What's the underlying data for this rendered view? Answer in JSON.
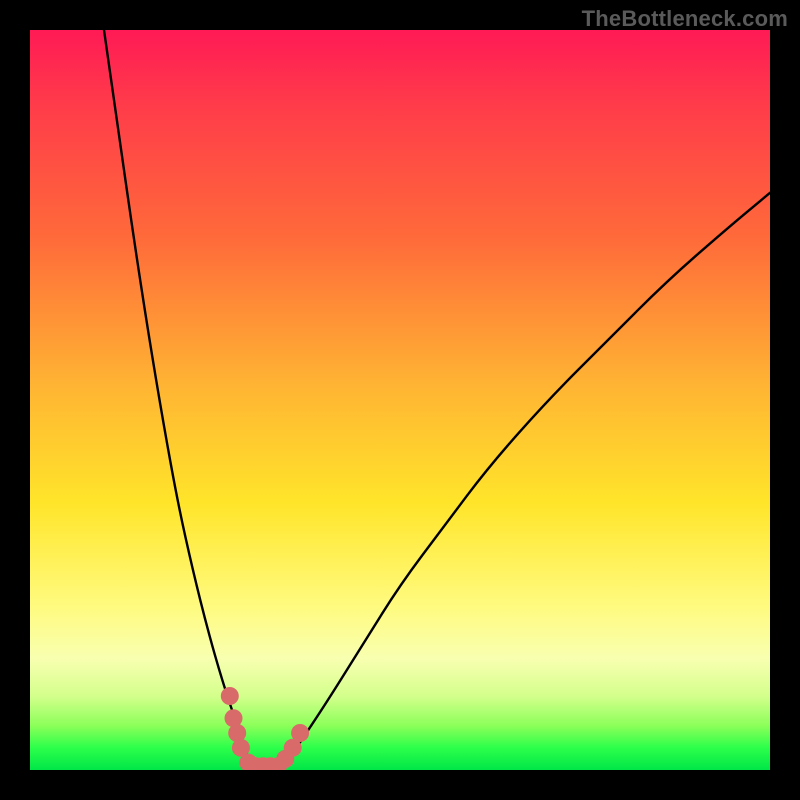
{
  "watermark": "TheBottleneck.com",
  "chart_data": {
    "type": "line",
    "title": "",
    "xlabel": "",
    "ylabel": "",
    "xlim": [
      0,
      100
    ],
    "ylim": [
      0,
      100
    ],
    "series": [
      {
        "name": "left-curve",
        "x": [
          10,
          12,
          14,
          16,
          18,
          20,
          22,
          24,
          26,
          28,
          29,
          30
        ],
        "y": [
          100,
          86,
          72,
          59,
          47,
          36,
          27,
          19,
          12,
          6,
          3,
          0
        ]
      },
      {
        "name": "right-curve",
        "x": [
          34,
          36,
          40,
          45,
          50,
          56,
          62,
          70,
          78,
          86,
          94,
          100
        ],
        "y": [
          0,
          3,
          9,
          17,
          25,
          33,
          41,
          50,
          58,
          66,
          73,
          78
        ]
      },
      {
        "name": "valley-floor",
        "x": [
          30,
          31,
          32,
          33,
          34
        ],
        "y": [
          0,
          0,
          0,
          0,
          0
        ]
      }
    ],
    "markers": [
      {
        "label": "m1",
        "x": 27.0,
        "y": 10.0
      },
      {
        "label": "m2",
        "x": 27.5,
        "y": 7.0
      },
      {
        "label": "m3",
        "x": 28.0,
        "y": 5.0
      },
      {
        "label": "m4",
        "x": 28.5,
        "y": 3.0
      },
      {
        "label": "m5",
        "x": 29.5,
        "y": 1.0
      },
      {
        "label": "m6",
        "x": 30.5,
        "y": 0.5
      },
      {
        "label": "m7",
        "x": 31.5,
        "y": 0.5
      },
      {
        "label": "m8",
        "x": 32.5,
        "y": 0.5
      },
      {
        "label": "m9",
        "x": 33.5,
        "y": 0.5
      },
      {
        "label": "m10",
        "x": 34.5,
        "y": 1.5
      },
      {
        "label": "m11",
        "x": 35.5,
        "y": 3.0
      },
      {
        "label": "m12",
        "x": 36.5,
        "y": 5.0
      }
    ],
    "marker_color": "#d96a6a",
    "curve_color": "#000000"
  }
}
